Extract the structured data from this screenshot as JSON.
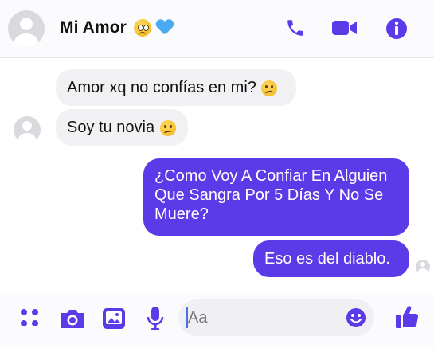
{
  "header": {
    "contact_name": "Mi Amor",
    "icons": [
      "pleading-face-emoji",
      "blue-heart-emoji",
      "phone-icon",
      "video-icon",
      "info-icon"
    ]
  },
  "messages": [
    {
      "from": "contact",
      "text": "Amor xq no confías en mi?",
      "emoji": "confused-face"
    },
    {
      "from": "contact",
      "text": "Soy tu novia",
      "emoji": "confused-face"
    },
    {
      "from": "me",
      "text": "¿Como Voy A Confiar En Alguien Que Sangra Por 5 Días Y No Se Muere?"
    },
    {
      "from": "me",
      "text": "Eso es del diablo."
    }
  ],
  "composer": {
    "placeholder": "Aa",
    "icons": [
      "menu-dots-icon",
      "camera-icon",
      "image-icon",
      "microphone-icon",
      "emoji-icon",
      "thumbs-up-icon"
    ]
  },
  "colors": {
    "accent": "#5b3ae8",
    "incoming_bubble": "#f1f1f4",
    "icon": "#5b3ae8"
  }
}
